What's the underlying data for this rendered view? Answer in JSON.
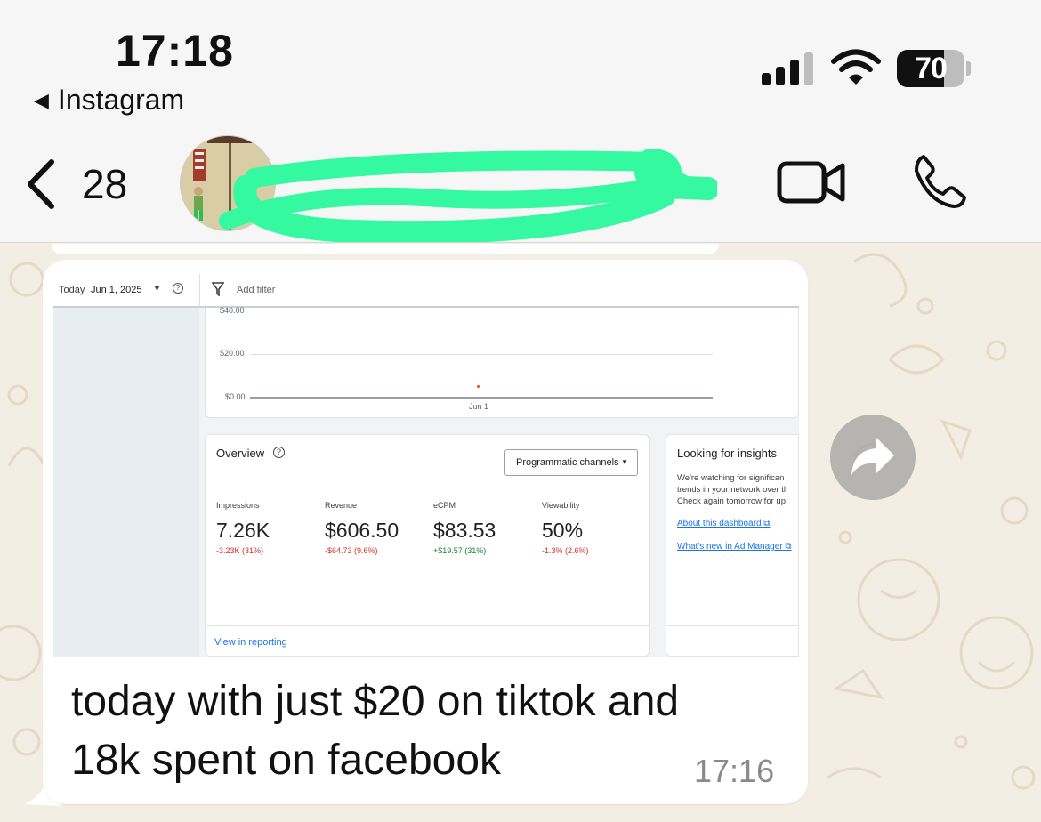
{
  "status_bar": {
    "time": "17:18",
    "back_app": "Instagram",
    "battery": "70",
    "battery_level": 0.7
  },
  "header": {
    "unread_count": "28",
    "contact_name": "",
    "accent_redact_color": "#35f9a0"
  },
  "screenshot": {
    "filter_bar": {
      "today_label": "Today",
      "date": "Jun 1, 2025",
      "add_filter": "Add filter"
    },
    "chart_data": {
      "type": "line",
      "x": [
        "Jun 1"
      ],
      "series": [
        {
          "values": [
            5
          ]
        }
      ],
      "yticks": [
        "$40.00",
        "$20.00",
        "$0.00"
      ],
      "xtick": "Jun 1",
      "ylim": [
        0,
        40
      ]
    },
    "overview": {
      "title": "Overview",
      "select": "Programmatic channels",
      "link": "View in reporting",
      "metrics": [
        {
          "label": "Impressions",
          "value": "7.26K",
          "delta": "-3.23K (31%)",
          "trend": "down"
        },
        {
          "label": "Revenue",
          "value": "$606.50",
          "delta": "-$64.73 (9.6%)",
          "trend": "down"
        },
        {
          "label": "eCPM",
          "value": "$83.53",
          "delta": "+$19.57 (31%)",
          "trend": "up"
        },
        {
          "label": "Viewability",
          "value": "50%",
          "delta": "-1.3% (2.6%)",
          "trend": "down"
        }
      ]
    },
    "insights": {
      "title": "Looking for insights",
      "body": [
        "We're watching for significan",
        "trends in your network over tl",
        "Check again tomorrow for up"
      ],
      "link1": "About this dashboard",
      "link2": "What's new in Ad Manager"
    }
  },
  "message": {
    "line1": "today with just $20 on tiktok and",
    "line2": "18k spent on facebook",
    "time": "17:16"
  },
  "colors": {
    "delta_down": "#d93025",
    "delta_up": "#188038",
    "link": "#1a73e8"
  }
}
